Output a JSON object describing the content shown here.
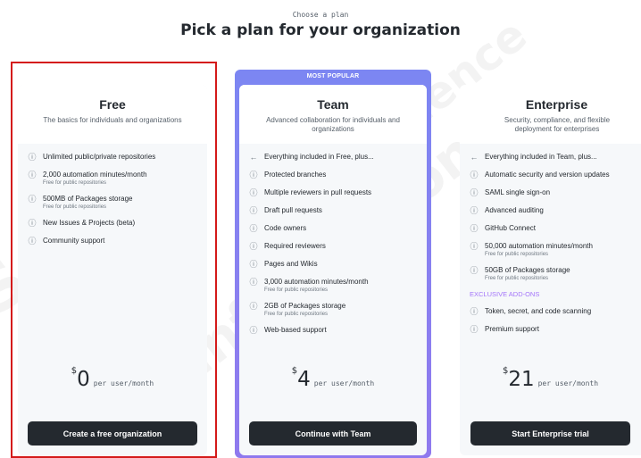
{
  "header": {
    "eyebrow": "Choose a plan",
    "title": "Pick a plan for your organization"
  },
  "badge": {
    "label": "MOST POPULAR"
  },
  "plans": [
    {
      "name": "Free",
      "description": "The basics for individuals and organizations",
      "features": [
        {
          "icon": "info-icon",
          "text": "Unlimited public/private repositories",
          "sub": ""
        },
        {
          "icon": "info-icon",
          "text": "2,000 automation minutes/month",
          "sub": "Free for public repositories"
        },
        {
          "icon": "info-icon",
          "text": "500MB of Packages storage",
          "sub": "Free for public repositories"
        },
        {
          "icon": "info-icon",
          "text": "New Issues & Projects (beta)",
          "sub": ""
        },
        {
          "icon": "info-icon",
          "text": "Community support",
          "sub": ""
        }
      ],
      "price": {
        "currency": "$",
        "amount": "0",
        "unit": "per user/month"
      },
      "cta": "Create a free organization"
    },
    {
      "name": "Team",
      "description": "Advanced collaboration for individuals and organizations",
      "features": [
        {
          "icon": "arrow-left-icon",
          "text": "Everything included in Free, plus...",
          "sub": ""
        },
        {
          "icon": "info-icon",
          "text": "Protected branches",
          "sub": ""
        },
        {
          "icon": "info-icon",
          "text": "Multiple reviewers in pull requests",
          "sub": ""
        },
        {
          "icon": "info-icon",
          "text": "Draft pull requests",
          "sub": ""
        },
        {
          "icon": "info-icon",
          "text": "Code owners",
          "sub": ""
        },
        {
          "icon": "info-icon",
          "text": "Required reviewers",
          "sub": ""
        },
        {
          "icon": "info-icon",
          "text": "Pages and Wikis",
          "sub": ""
        },
        {
          "icon": "info-icon",
          "text": "3,000 automation minutes/month",
          "sub": "Free for public repositories"
        },
        {
          "icon": "info-icon",
          "text": "2GB of Packages storage",
          "sub": "Free for public repositories"
        },
        {
          "icon": "info-icon",
          "text": "Web-based support",
          "sub": ""
        }
      ],
      "price": {
        "currency": "$",
        "amount": "4",
        "unit": "per user/month"
      },
      "cta": "Continue with Team"
    },
    {
      "name": "Enterprise",
      "description": "Security, compliance, and flexible deployment for enterprises",
      "features": [
        {
          "icon": "arrow-left-icon",
          "text": "Everything included in Team, plus...",
          "sub": ""
        },
        {
          "icon": "info-icon",
          "text": "Automatic security and version updates",
          "sub": ""
        },
        {
          "icon": "info-icon",
          "text": "SAML single sign-on",
          "sub": ""
        },
        {
          "icon": "info-icon",
          "text": "Advanced auditing",
          "sub": ""
        },
        {
          "icon": "info-icon",
          "text": "GitHub Connect",
          "sub": ""
        },
        {
          "icon": "info-icon",
          "text": "50,000 automation minutes/month",
          "sub": "Free for public repositories"
        },
        {
          "icon": "info-icon",
          "text": "50GB of Packages storage",
          "sub": "Free for public repositories"
        }
      ],
      "addons_title": "EXCLUSIVE ADD-ONS",
      "addons": [
        {
          "icon": "info-icon",
          "text": "Token, secret, and code scanning",
          "sub": ""
        },
        {
          "icon": "info-icon",
          "text": "Premium support",
          "sub": ""
        }
      ],
      "price": {
        "currency": "$",
        "amount": "21",
        "unit": "per user/month"
      },
      "cta": "Start Enterprise trial"
    }
  ],
  "colors": {
    "highlight_border": "#d41a1a",
    "popular_gradient_start": "#7c86f2",
    "popular_gradient_end": "#8f79ee",
    "button_bg": "#24292f",
    "addon_heading": "#a475f9"
  }
}
